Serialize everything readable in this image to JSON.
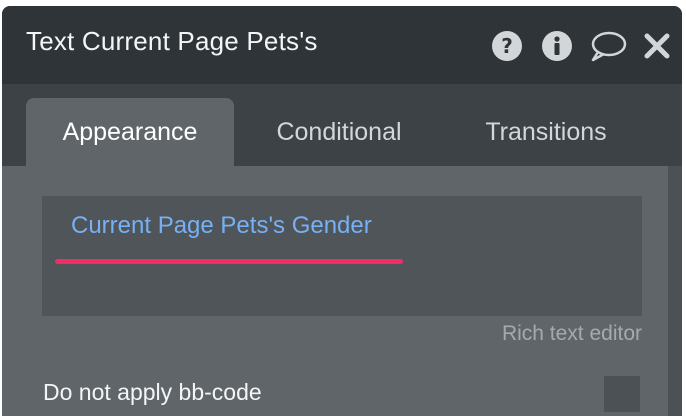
{
  "header": {
    "title": "Text Current Page Pets's",
    "icons": [
      "help-icon",
      "info-icon",
      "comment-icon",
      "close-icon"
    ]
  },
  "tabs": [
    {
      "label": "Appearance",
      "active": true
    },
    {
      "label": "Conditional",
      "active": false
    },
    {
      "label": "Transitions",
      "active": false
    }
  ],
  "editor": {
    "value": "Current Page Pets's Gender",
    "label": "Rich text editor"
  },
  "options": {
    "bbcode_label": "Do not apply bb-code"
  },
  "colors": {
    "dynamic_text": "#77b0f5",
    "highlight": "#ef2d66",
    "header_bg": "#2e3437",
    "panel_bg": "#5f6569"
  }
}
